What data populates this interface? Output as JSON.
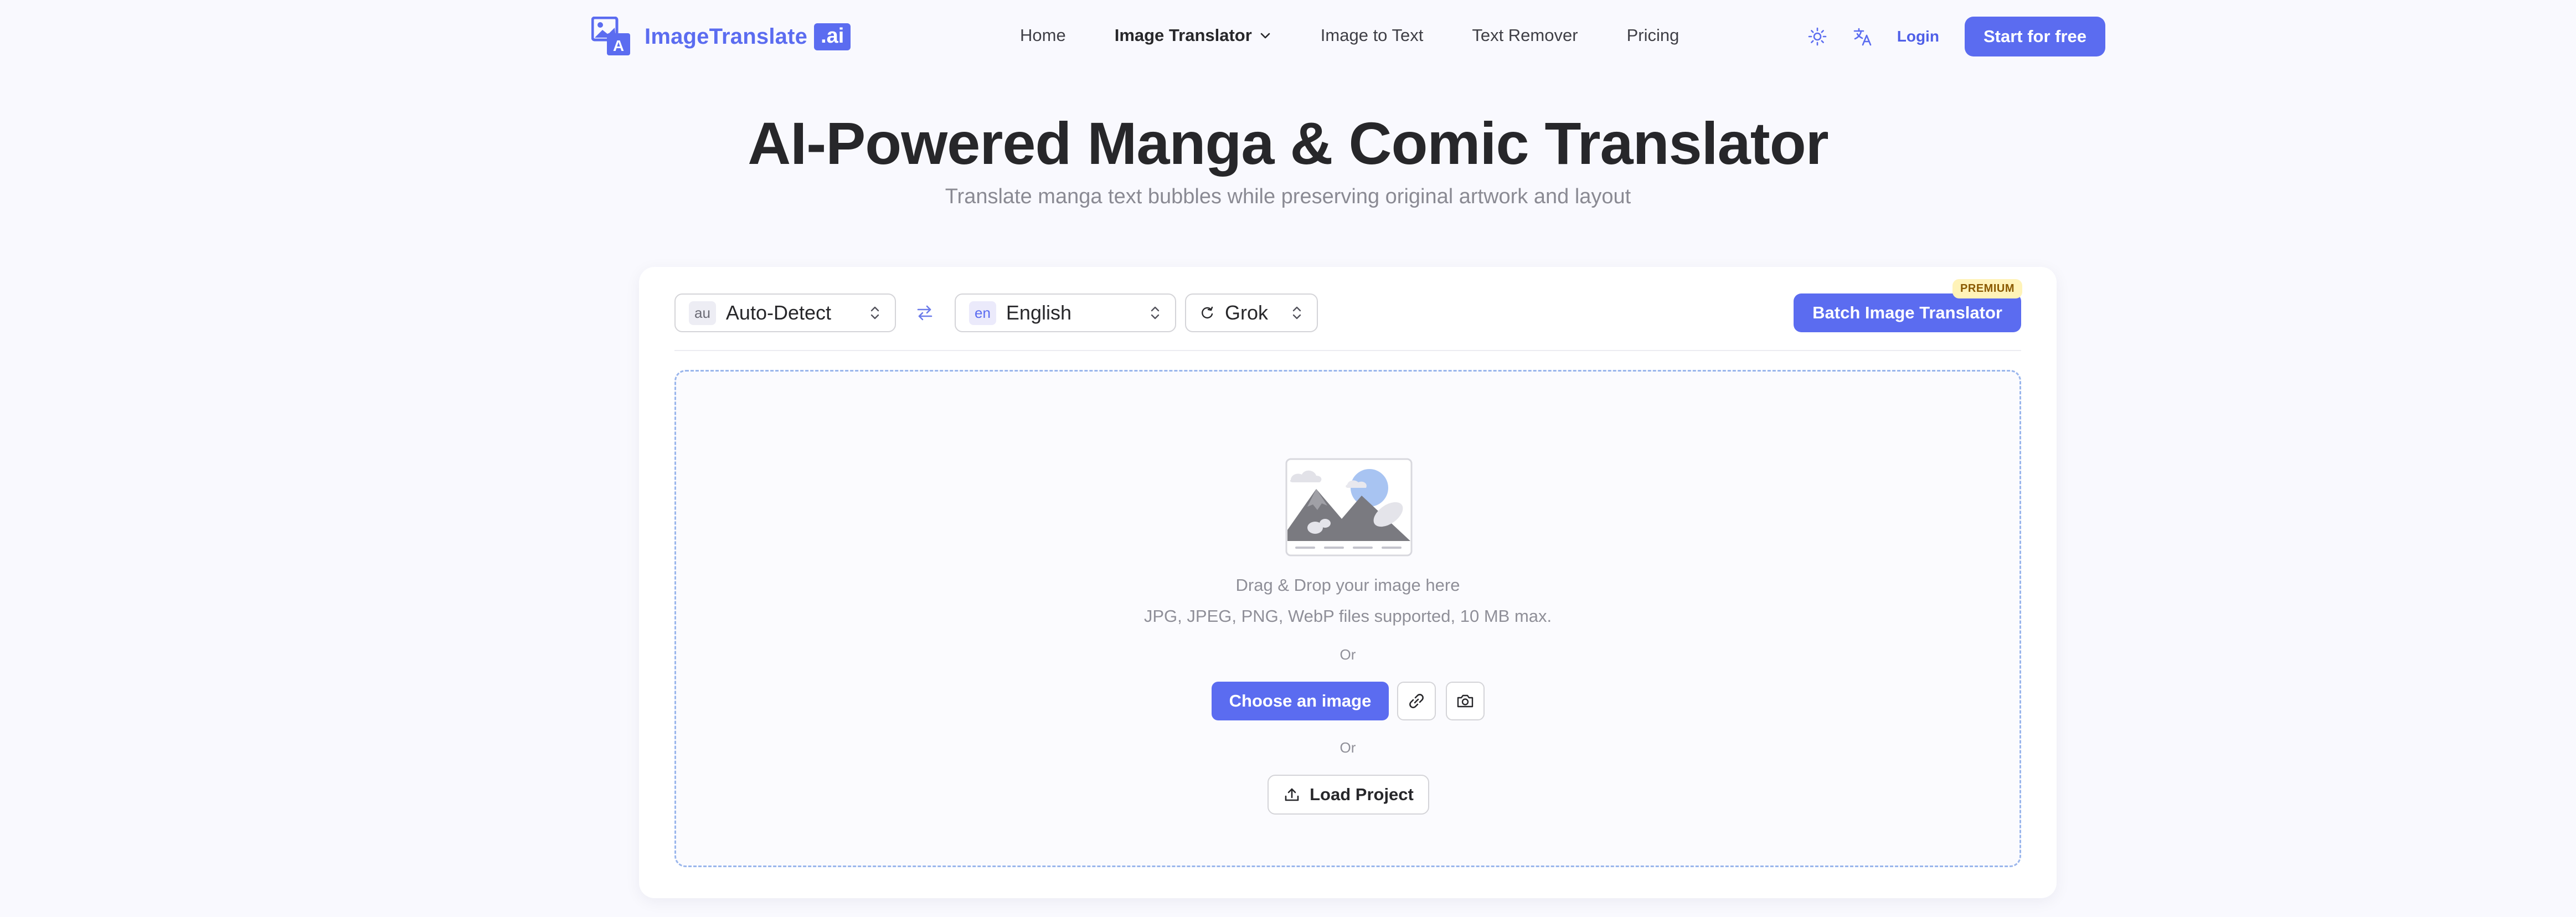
{
  "brand": {
    "name": "ImageTranslate",
    "suffix": ".ai",
    "accent": "#5b6cf0"
  },
  "nav": {
    "items": [
      {
        "label": "Home"
      },
      {
        "label": "Image Translator"
      },
      {
        "label": "Image to Text"
      },
      {
        "label": "Text Remover"
      },
      {
        "label": "Pricing"
      }
    ],
    "theme_icon": "sun-icon",
    "language_icon": "translate-icon",
    "login_label": "Login",
    "cta_label": "Start for free"
  },
  "hero": {
    "title": "AI-Powered Manga & Comic Translator",
    "subtitle": "Translate manga text bubbles while preserving original artwork and layout"
  },
  "toolbar": {
    "source": {
      "code": "au",
      "label": "Auto-Detect"
    },
    "target": {
      "code": "en",
      "label": "English"
    },
    "model": {
      "label": "Grok"
    },
    "batch_label": "Batch Image Translator",
    "premium_badge": "PREMIUM"
  },
  "dropzone": {
    "title": "Drag & Drop your image here",
    "subtitle": "JPG, JPEG, PNG, WebP files supported, 10 MB max.",
    "or_1": "Or",
    "choose_label": "Choose an image",
    "or_2": "Or",
    "load_label": "Load Project",
    "border_color": "#9ab6ec"
  }
}
